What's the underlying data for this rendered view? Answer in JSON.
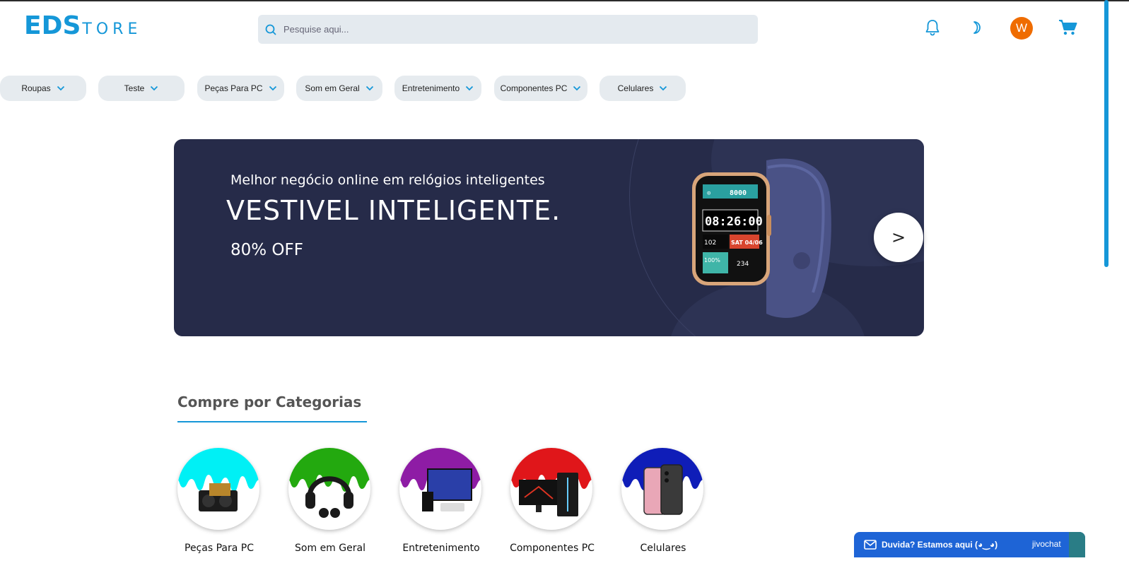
{
  "header": {
    "logo_bold": "EDS",
    "logo_rest": "TORE",
    "search_placeholder": "Pesquise aqui...",
    "avatar_initial": "W",
    "accent_color": "#1597d8",
    "avatar_color": "#ef6c00"
  },
  "nav": {
    "categories": [
      "Roupas",
      "Teste",
      "Peças Para PC",
      "Som em Geral",
      "Entretenimento",
      "Componentes PC",
      "Celulares"
    ]
  },
  "banner": {
    "subtitle": "Melhor negócio online em relógios inteligentes",
    "title": "VESTIVEL INTELIGENTE.",
    "offer": "80% OFF",
    "next_label": ">",
    "watch_time": "08:26:00",
    "watch_steps": "8000",
    "watch_hr": "102",
    "watch_date": "SAT 04/06",
    "watch_battery": "100%",
    "watch_kcal": "234",
    "background": "#262b49"
  },
  "section": {
    "title": "Compre por Categorias",
    "items": [
      {
        "label": "Peças Para PC",
        "color": "#00f0f5"
      },
      {
        "label": "Som em Geral",
        "color": "#23a90f"
      },
      {
        "label": "Entretenimento",
        "color": "#8e1ca5"
      },
      {
        "label": "Componentes PC",
        "color": "#e0161a"
      },
      {
        "label": "Celulares",
        "color": "#0f1db8"
      }
    ]
  },
  "chat": {
    "label": "Duvida? Estamos aqui (◕‿◕)",
    "brand": "jivochat"
  },
  "icons": {
    "search": "search-icon",
    "bell": "bell-icon",
    "theme": "moon-icon",
    "cart": "cart-icon",
    "chevron": "chevron-down-icon",
    "mail": "mail-icon"
  }
}
